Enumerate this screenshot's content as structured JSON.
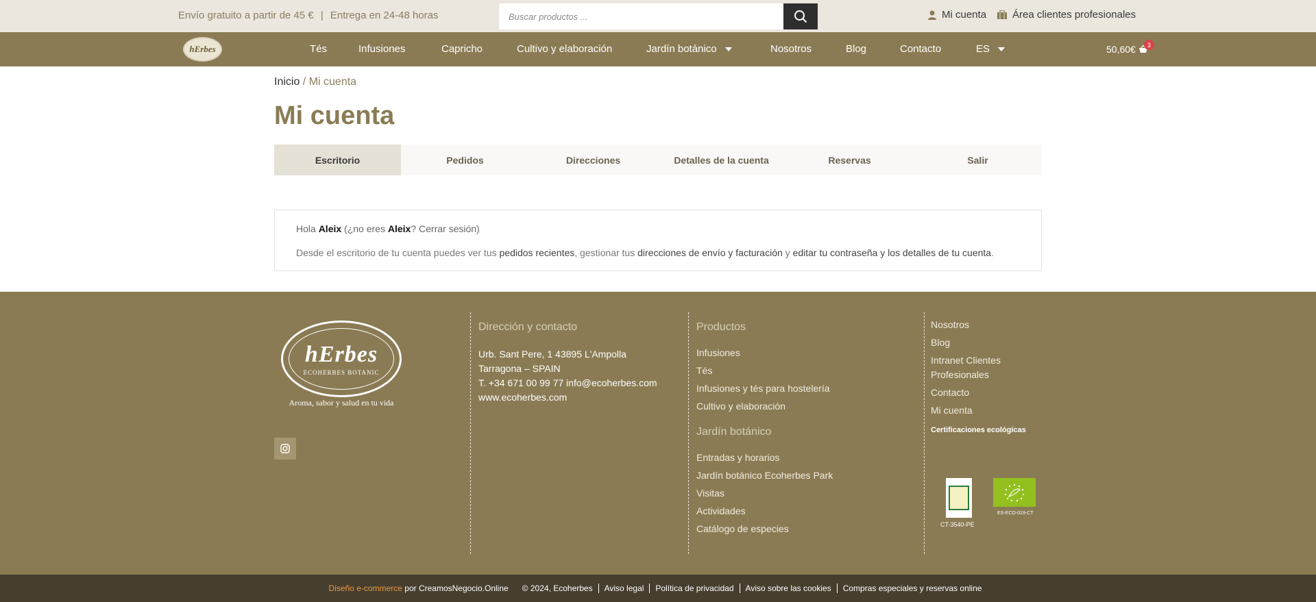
{
  "topbar": {
    "promo_shipping": "Envío gratuito a partir de 45 €",
    "promo_separator": "|",
    "promo_delivery": "Entrega en 24-48 horas",
    "search_placeholder": "Buscar productos ...",
    "account_label": "Mi cuenta",
    "pro_area_label": "Área clientes profesionales"
  },
  "nav": {
    "logo_text": "hErbes",
    "items": [
      "Tés",
      "Infusiones",
      "Capricho",
      "Cultivo y elaboración",
      "Jardín botánico",
      "Nosotros",
      "Blog",
      "Contacto",
      "ES"
    ],
    "cart_total": "50,60€",
    "cart_count": "3"
  },
  "breadcrumb": {
    "home": "Inicio",
    "separator": " / ",
    "current": "Mi cuenta"
  },
  "page_title": "Mi cuenta",
  "tabs": [
    "Escritorio",
    "Pedidos",
    "Direcciones",
    "Detalles de la cuenta",
    "Reservas",
    "Salir"
  ],
  "greeting": {
    "hola": "Hola",
    "name": "Aleix",
    "not_you_open": " (¿no eres ",
    "name2": "Aleix",
    "q": "? ",
    "logout": "Cerrar sesión",
    "close": ")",
    "desc_1": "Desde el escritorio de tu cuenta puedes ver tus ",
    "link_orders": "pedidos recientes",
    "desc_2": ", gestionar tus ",
    "link_addresses": "direcciones de envío y facturación",
    "desc_3": " y ",
    "link_edit": "editar tu contraseña y los detalles de tu cuenta",
    "desc_4": "."
  },
  "footer": {
    "logo_text": "hErbes",
    "logo_ring": "ECOHERBES BOTANIC",
    "tagline": "Aroma, sabor y salud en tu vida",
    "contact": {
      "title": "Dirección y contacto",
      "address1": "Urb. Sant Pere, 1 43895 L'Ampolla",
      "address2": "Tarragona – SPAIN",
      "phone": "T. +34 671 00 99 77 info@ecoherbes.com",
      "web": "www.ecoherbes.com"
    },
    "products": {
      "title": "Productos",
      "items": [
        "Infusiones",
        "Tés",
        "Infusiones y tés para hostelería",
        "Cultivo y elaboración"
      ]
    },
    "garden": {
      "title": "Jardín botánico",
      "items": [
        "Entradas y horarios",
        "Jardín botánico Ecoherbes Park",
        "Visitas",
        "Actividades",
        "Catálogo de especies"
      ]
    },
    "links": [
      "Nosotros",
      "Blog",
      "Intranet Clientes Profesionales",
      "Contacto",
      "Mi cuenta"
    ],
    "cert_title": "Certificaciones ecológicas",
    "cert1_label": "CT-3540-PE",
    "cert2_label": "ES-ECO-019-CT"
  },
  "bottom": {
    "design": "Diseño e-commerce",
    "by": "por CreamosNegocio.Online",
    "copyright": "© 2024, Ecoherbes",
    "legal": "Aviso legal",
    "privacy": "Política de privacidad",
    "cookies": "Aviso sobre las cookies",
    "special": "Compras especiales y reservas online"
  },
  "colors": {
    "brand": "#8a7b54",
    "topbar": "#ebe7df",
    "bottombar": "#463e2e",
    "accent": "#e89a43",
    "badge": "#d9434a"
  }
}
